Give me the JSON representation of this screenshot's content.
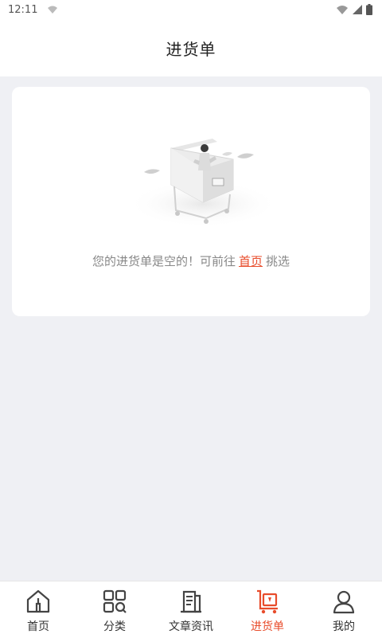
{
  "status_bar": {
    "time": "12:11"
  },
  "header": {
    "title": "进货单"
  },
  "empty_state": {
    "message_prefix": "您的进货单是空的！可前往",
    "link_text": "首页",
    "message_suffix": "挑选"
  },
  "tab_bar": {
    "active_color": "#e84c2b",
    "items": [
      {
        "label": "首页",
        "icon": "home-icon"
      },
      {
        "label": "分类",
        "icon": "category-icon"
      },
      {
        "label": "文章资讯",
        "icon": "article-icon"
      },
      {
        "label": "进货单",
        "icon": "cart-icon",
        "active": true
      },
      {
        "label": "我的",
        "icon": "profile-icon"
      }
    ]
  }
}
